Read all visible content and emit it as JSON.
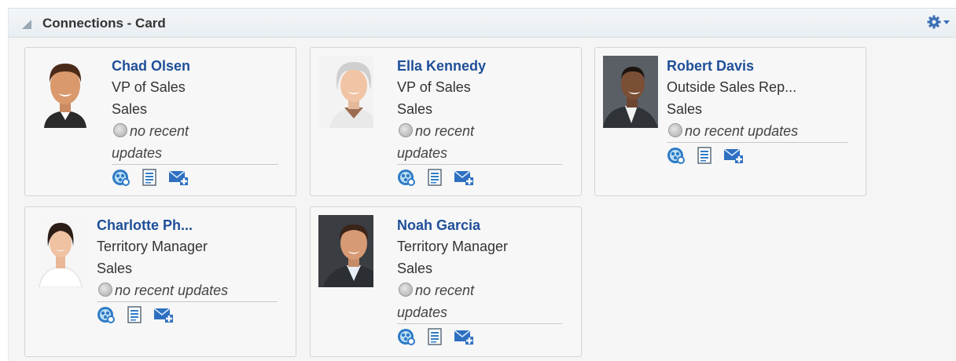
{
  "panel": {
    "title": "Connections - Card"
  },
  "status_text": "no recent updates",
  "status_parts": [
    "no recent",
    "updates"
  ],
  "cards": [
    {
      "name": "Chad Olsen",
      "title": "VP of Sales",
      "department": "Sales"
    },
    {
      "name": "Ella Kennedy",
      "title": "VP of Sales",
      "department": "Sales"
    },
    {
      "name": "Robert Davis",
      "title": "Outside Sales Rep...",
      "department": "Sales"
    },
    {
      "name": "Charlotte Ph...",
      "title": "Territory Manager",
      "department": "Sales"
    },
    {
      "name": "Noah Garcia",
      "title": "Territory Manager",
      "department": "Sales"
    }
  ],
  "icons": [
    "collapse-triangle-icon",
    "gear-menu-icon",
    "network-icon",
    "profile-document-icon",
    "send-message-icon"
  ],
  "colors": {
    "link": "#1f4f99",
    "header_bg": "#eef2f5",
    "card_border": "#cfd6dc"
  }
}
